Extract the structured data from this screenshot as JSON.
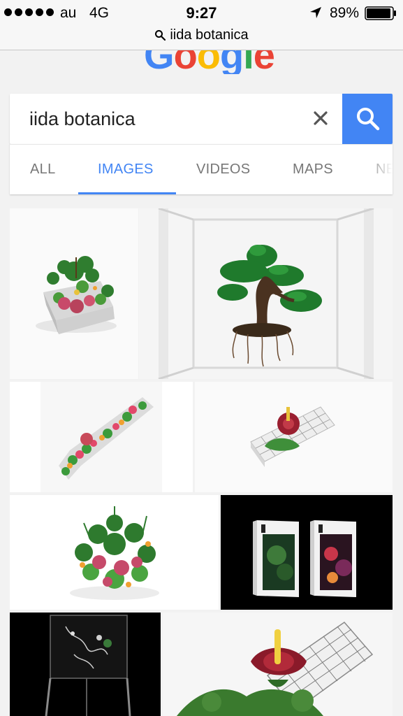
{
  "status_bar": {
    "carrier": "au",
    "network": "4G",
    "time": "9:27",
    "battery_percent": "89%",
    "signal_icon": "signal-dots-icon",
    "location_icon": "location-arrow-icon",
    "battery_icon": "battery-icon"
  },
  "url_bar": {
    "text": "iida botanica",
    "icon": "search-icon"
  },
  "logo": {
    "text": "Google",
    "colors": [
      "#4285f4",
      "#ea4335",
      "#fbbc05",
      "#4285f4",
      "#34a853",
      "#ea4335"
    ]
  },
  "search": {
    "query": "iida botanica",
    "clear_icon": "close-icon",
    "submit_icon": "search-icon",
    "accent": "#4285f4"
  },
  "tabs": [
    {
      "label": "ALL",
      "active": false
    },
    {
      "label": "IMAGES",
      "active": true
    },
    {
      "label": "VIDEOS",
      "active": false
    },
    {
      "label": "MAPS",
      "active": false
    },
    {
      "label": "NE",
      "active": false
    }
  ],
  "results": [
    {
      "description_icon": "botanical-planter-image"
    },
    {
      "description_icon": "bonsai-tree-image"
    },
    {
      "description_icon": "flower-bed-sculpture-image"
    },
    {
      "description_icon": "red-flower-grid-image"
    },
    {
      "description_icon": "plant-cluster-image"
    },
    {
      "description_icon": "book-covers-image"
    },
    {
      "description_icon": "glass-case-image"
    },
    {
      "description_icon": "red-flower-closeup-image"
    }
  ]
}
